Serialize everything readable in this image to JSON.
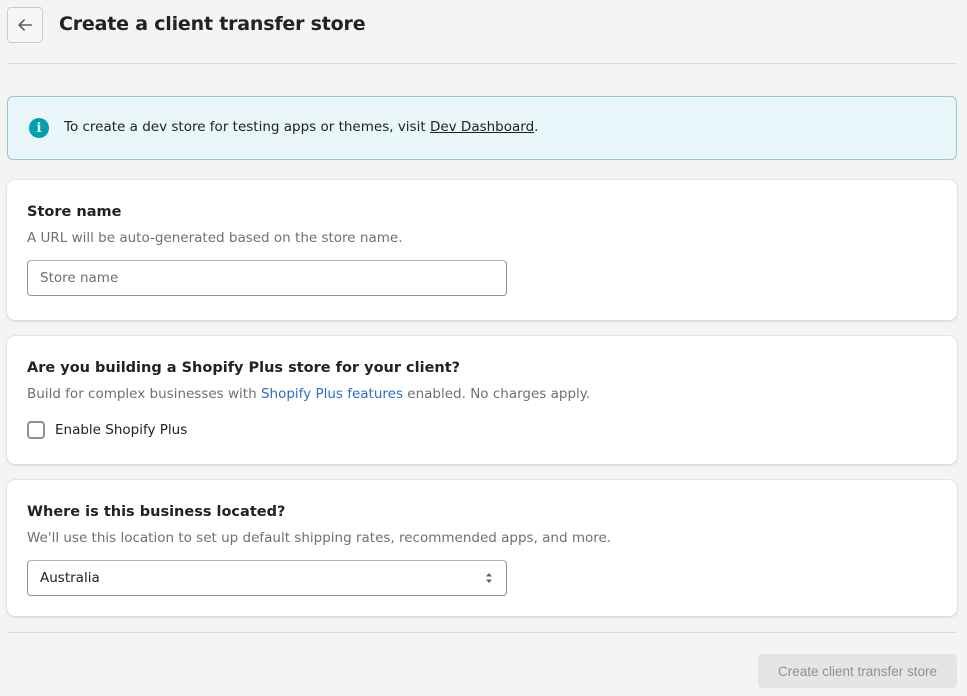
{
  "header": {
    "title": "Create a client transfer store",
    "back_icon": "arrow-left-icon"
  },
  "banner": {
    "icon": "info-icon",
    "icon_glyph": "i",
    "text_before": "To create a dev store for testing apps or themes, visit ",
    "link_text": "Dev Dashboard",
    "text_after": ".",
    "accent_color": "#00a0ac"
  },
  "store_name_card": {
    "title": "Store name",
    "subtitle": "A URL will be auto-generated based on the store name.",
    "input_value": "",
    "input_placeholder": "Store name"
  },
  "plus_card": {
    "title": "Are you building a Shopify Plus store for your client?",
    "subtitle_before": "Build for complex businesses with ",
    "subtitle_link": "Shopify Plus features",
    "subtitle_after": " enabled. No charges apply.",
    "checkbox_label": "Enable Shopify Plus",
    "checkbox_checked": false,
    "link_color": "#2c6ecb"
  },
  "location_card": {
    "title": "Where is this business located?",
    "subtitle": "We'll use this location to set up default shipping rates, recommended apps, and more.",
    "selected_country": "Australia",
    "select_icon": "select-arrows-icon"
  },
  "footer": {
    "submit_label": "Create client transfer store",
    "submit_disabled": true
  }
}
